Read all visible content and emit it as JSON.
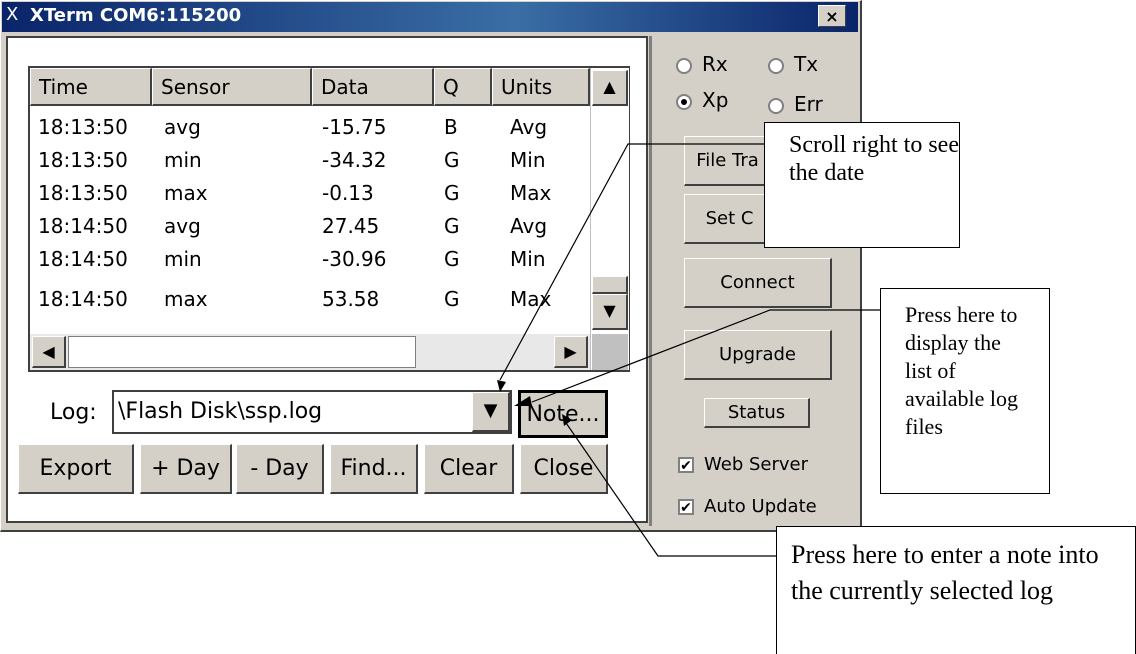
{
  "window": {
    "title_icon": "X",
    "title": "XTerm COM6:115200",
    "close_label": "×"
  },
  "table": {
    "columns": [
      "Time",
      "Sensor",
      "Data",
      "Q",
      "Units"
    ],
    "rows": [
      [
        "18:13:50",
        "avg",
        "-15.75",
        "B",
        "Avg"
      ],
      [
        "18:13:50",
        "min",
        "-34.32",
        "G",
        "Min"
      ],
      [
        "18:13:50",
        "max",
        "-0.13",
        "G",
        "Max"
      ],
      [
        "18:14:50",
        "avg",
        "27.45",
        "G",
        "Avg"
      ],
      [
        "18:14:50",
        "min",
        "-30.96",
        "G",
        "Min"
      ],
      [
        "18:14:50",
        "max",
        "53.58",
        "G",
        "Max"
      ]
    ]
  },
  "log": {
    "label": "Log:",
    "value": "\\Flash Disk\\ssp.log",
    "note_label": "Note..."
  },
  "buttons": {
    "export": "Export",
    "plus_day": "+ Day",
    "minus_day": "- Day",
    "find": "Find...",
    "clear": "Clear",
    "close": "Close"
  },
  "panel": {
    "rx": "Rx",
    "tx": "Tx",
    "xp": "Xp",
    "err": "Err",
    "file_transfer": "File Tra",
    "set_clock": "Set C",
    "connect": "Connect",
    "upgrade": "Upgrade",
    "status": "Status",
    "web_server": "Web Server",
    "auto_update": "Auto Update",
    "selected_radio": "Xp"
  },
  "callouts": {
    "scroll": "Scroll right to see the date",
    "press_log": "Press here to display the list of available log files",
    "press_note": "Press here to enter a note into the currently selected log"
  }
}
